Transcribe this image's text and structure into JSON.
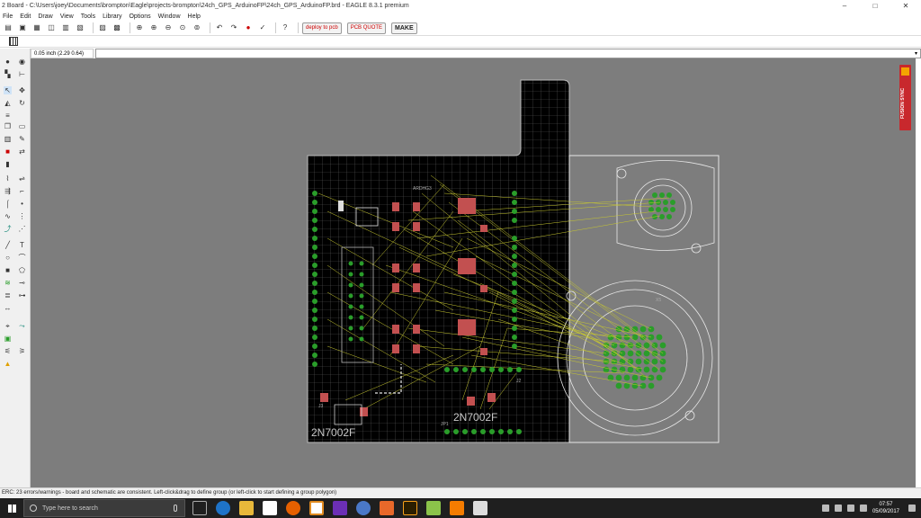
{
  "window": {
    "title": "2 Board - C:\\Users\\joey\\Documents\\brompton\\Eagle\\projects-brompton\\24ch_GPS_ArduinoFP\\24ch_GPS_ArduinoFP.brd - EAGLE 8.3.1 premium",
    "min": "–",
    "max": "□",
    "close": "✕"
  },
  "menu": [
    "File",
    "Edit",
    "Draw",
    "View",
    "Tools",
    "Library",
    "Options",
    "Window",
    "Help"
  ],
  "toolbar": {
    "deploy_label": "deploy to pcb",
    "pcbquote_label": "PCB QUOTE",
    "make_label": "MAKE"
  },
  "coords": {
    "display": "0.05 inch (2.29 0.64)",
    "command_value": ""
  },
  "fusion": {
    "label": "FUSION SYNC"
  },
  "board": {
    "part_labels": [
      "2N7002F",
      "2N7002F"
    ],
    "small_labels": [
      "ARDHG3",
      "X5",
      "J2",
      "JP1",
      "J3"
    ]
  },
  "status": {
    "text": "ERC: 23 errors/warnings - board and schematic are consistent. Left-click&drag to define group (or left-click to start defining a group polygon)"
  },
  "taskbar": {
    "search_placeholder": "Type here to search",
    "time": "07:57",
    "date": "05/09/2017"
  },
  "colors": {
    "canvas": "#7d7d7d",
    "board": "#000000",
    "grid": "#5a5a5a",
    "airwire": "#c8c830",
    "pad": "#2a9d2a",
    "part": "#c25050",
    "outline": "#e8e8e8",
    "fusion": "#c8282d"
  }
}
